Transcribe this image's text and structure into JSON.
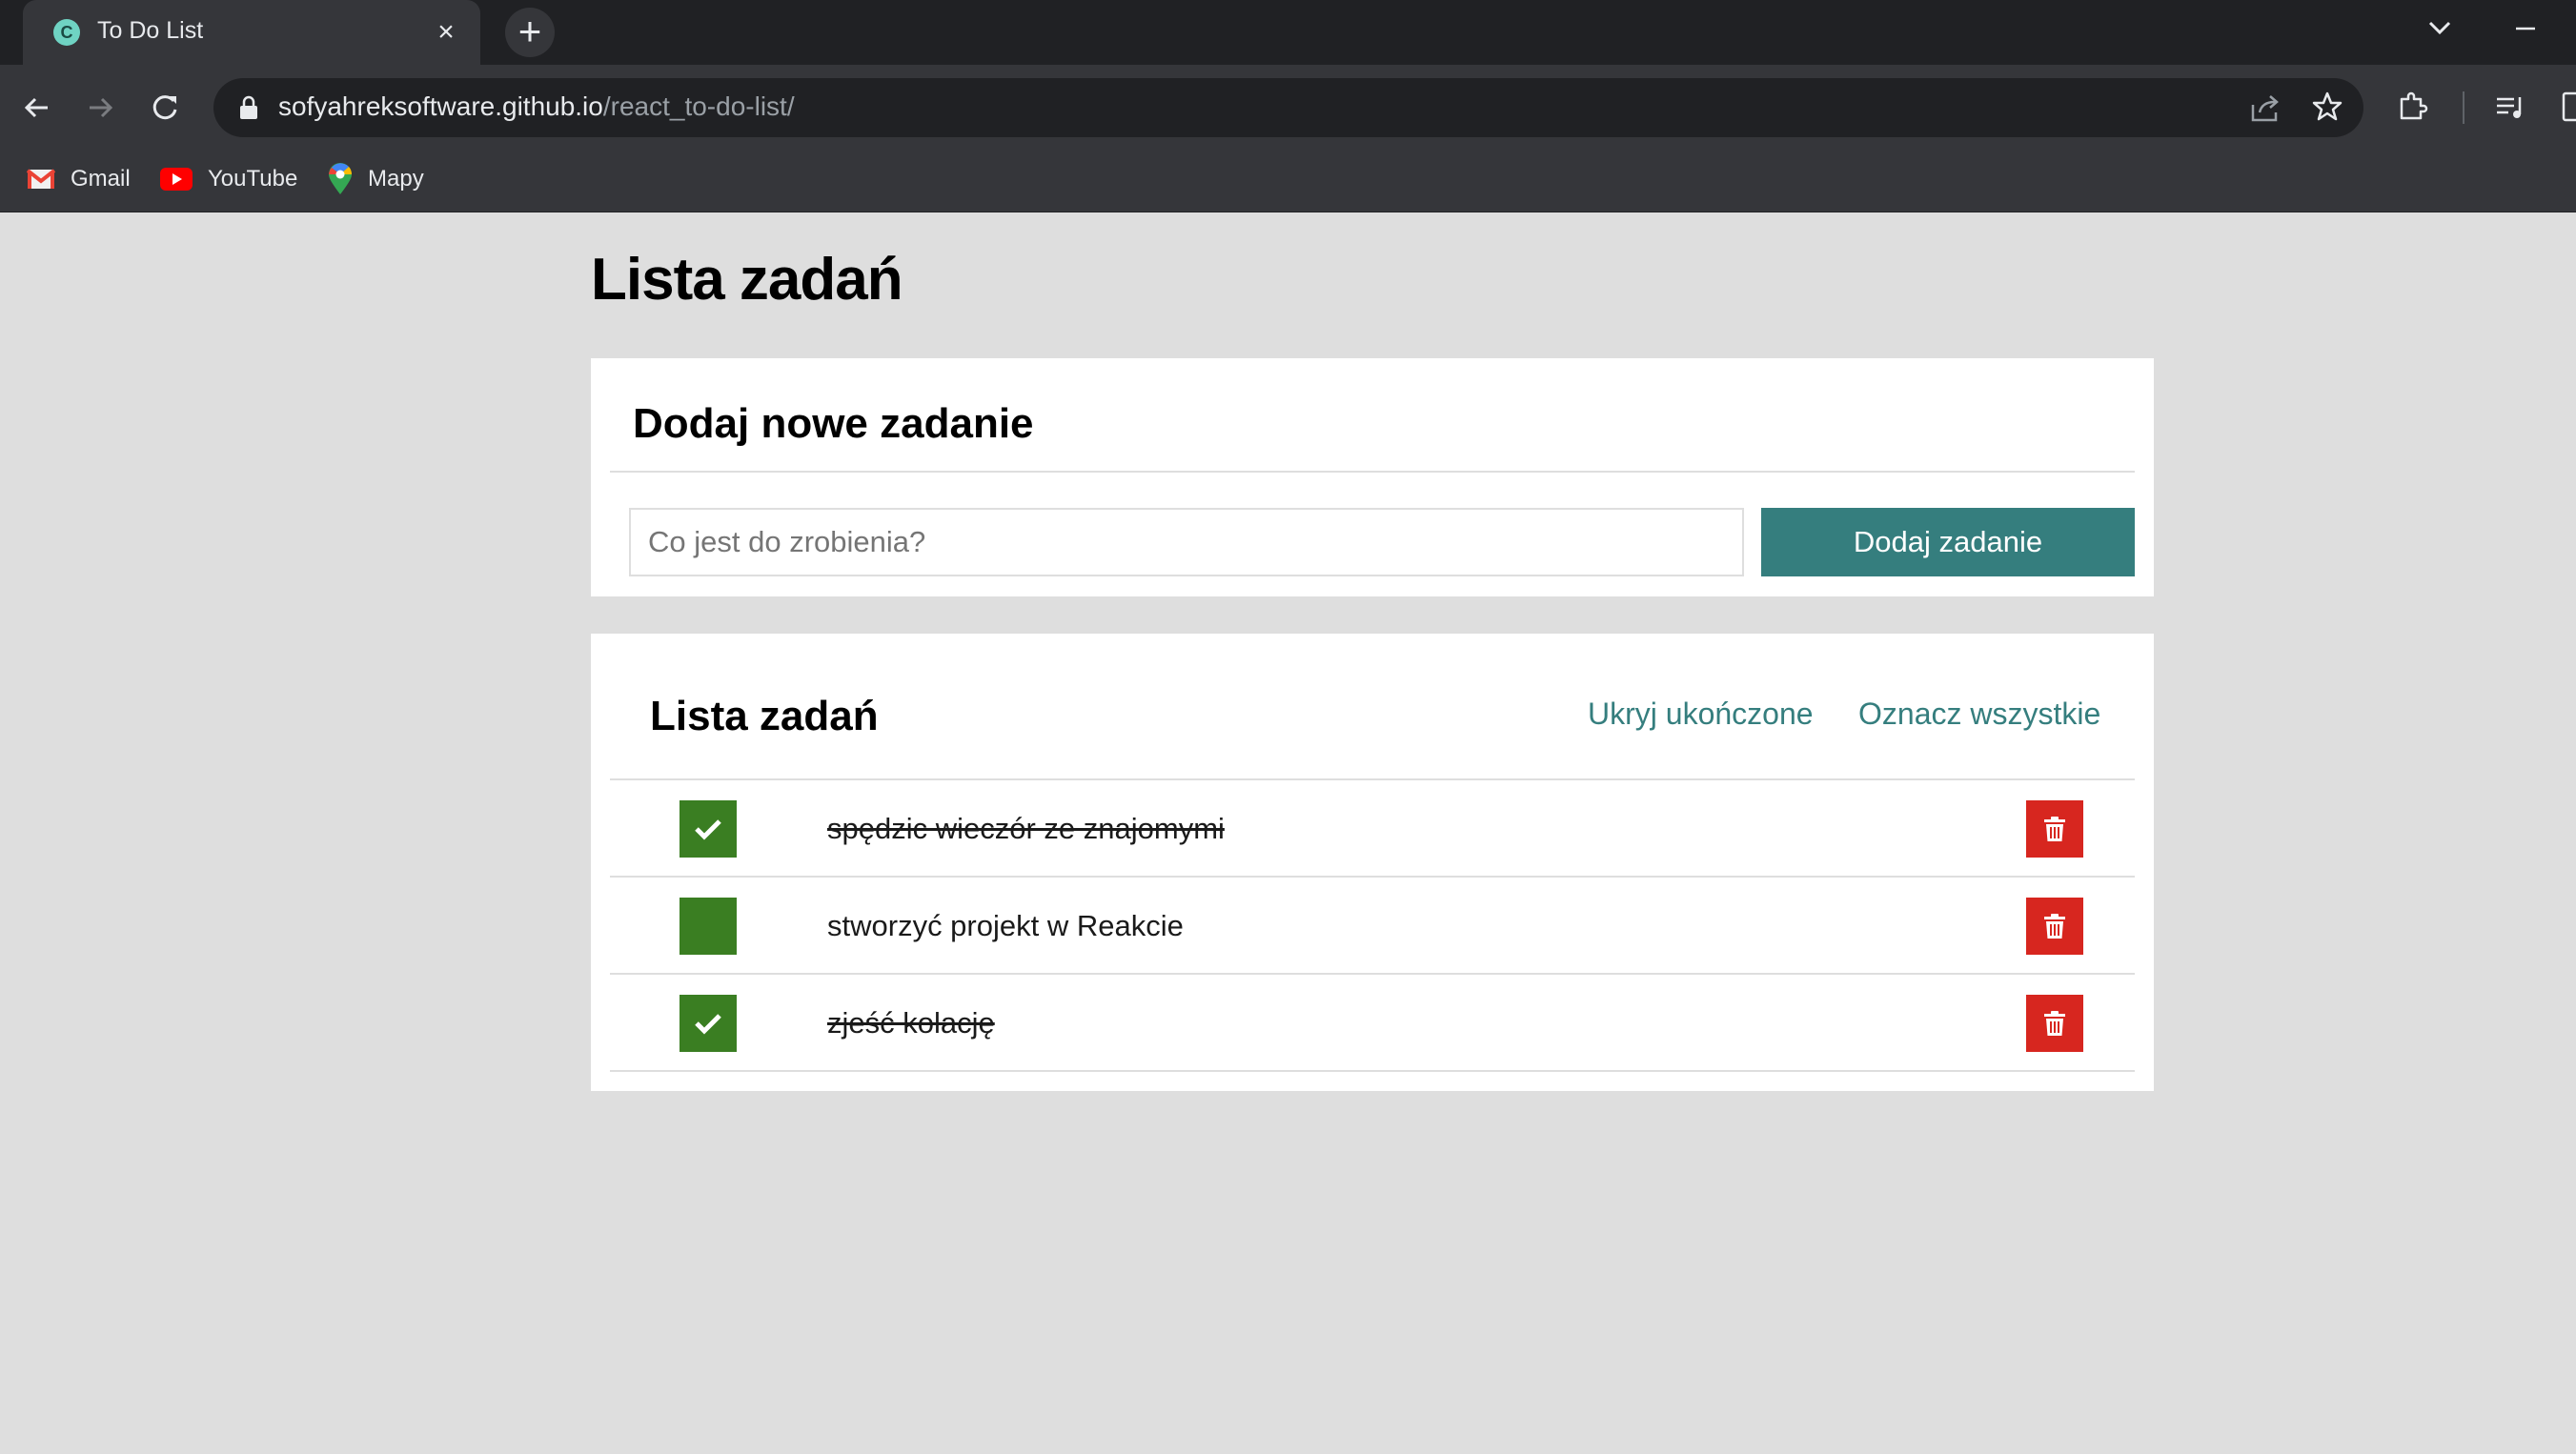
{
  "browser": {
    "tab_title": "To Do List",
    "tab_favicon": "C",
    "url_host": "sofyahreksoftware.github.io",
    "url_path": "/react_to-do-list/",
    "bookmarks": [
      {
        "label": "Gmail",
        "icon": "gmail-icon"
      },
      {
        "label": "YouTube",
        "icon": "youtube-icon"
      },
      {
        "label": "Mapy",
        "icon": "maps-icon"
      }
    ]
  },
  "page": {
    "title": "Lista zadań"
  },
  "add_section": {
    "heading": "Dodaj nowe zadanie",
    "input_value": "",
    "input_placeholder": "Co jest do zrobienia?",
    "button_label": "Dodaj zadanie"
  },
  "list_section": {
    "heading": "Lista zadań",
    "hide_done_label": "Ukryj ukończone",
    "mark_all_label": "Oznacz wszystkie",
    "tasks": [
      {
        "content": "spędzic wieczór ze znajomymi",
        "done": true
      },
      {
        "content": "stworzyć projekt w Reakcie",
        "done": false
      },
      {
        "content": "zjeść kolację",
        "done": true
      }
    ]
  },
  "colors": {
    "accent": "#357e7e",
    "checkbox": "#3a7e22",
    "delete": "#d7261f",
    "background": "#dedede"
  }
}
